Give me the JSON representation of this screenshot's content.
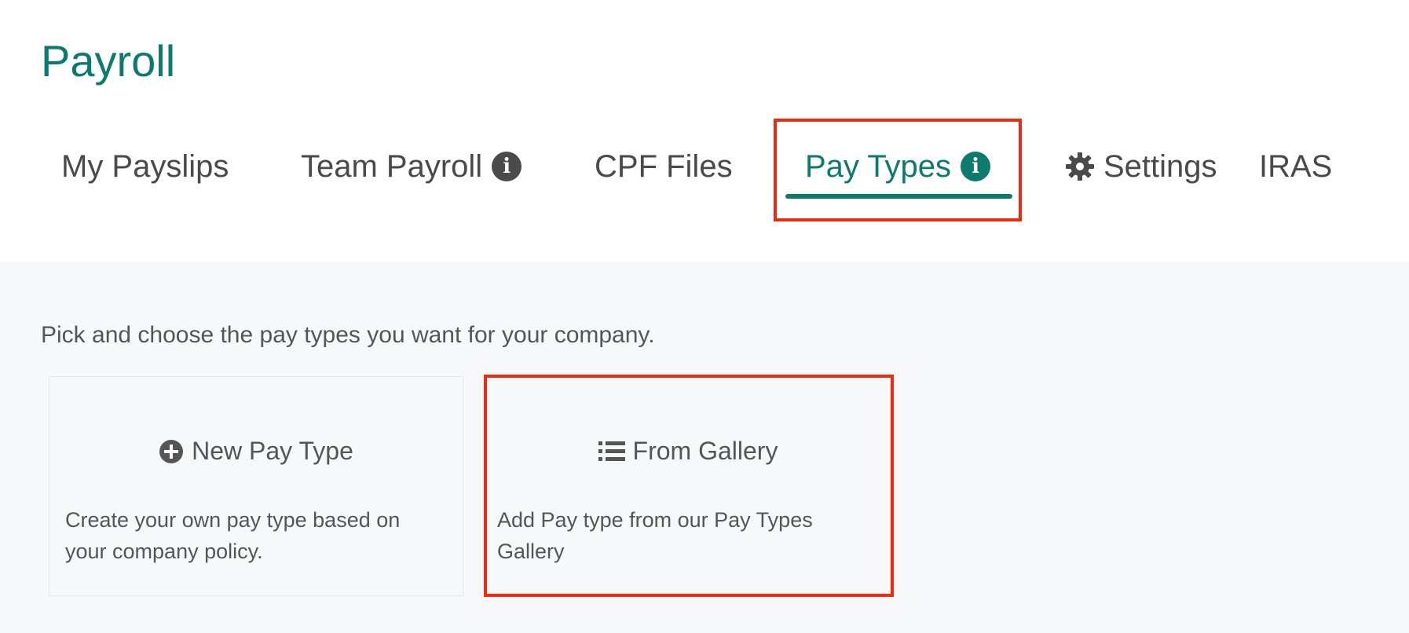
{
  "page": {
    "title": "Payroll"
  },
  "tabs": [
    {
      "label": "My Payslips",
      "icon": null,
      "active": false
    },
    {
      "label": "Team Payroll",
      "icon": "info-icon",
      "active": false
    },
    {
      "label": "CPF Files",
      "icon": null,
      "active": false
    },
    {
      "label": "Pay Types",
      "icon": "info-icon",
      "active": true
    },
    {
      "label": "Settings",
      "icon": "gear-icon",
      "active": false
    },
    {
      "label": "IRAS",
      "icon": null,
      "active": false
    }
  ],
  "intro_text": "Pick and choose the pay types you want for your company.",
  "cards": [
    {
      "title": "New Pay Type",
      "icon": "plus-circle-icon",
      "description": "Create your own pay type based on your company policy."
    },
    {
      "title": "From Gallery",
      "icon": "list-icon",
      "description": "Add Pay type from our Pay Types Gallery"
    }
  ],
  "colors": {
    "brand": "#0e7a6e",
    "text": "#4a4a4a",
    "highlight": "#ee2a10",
    "content_bg": "#f7f8f9"
  }
}
